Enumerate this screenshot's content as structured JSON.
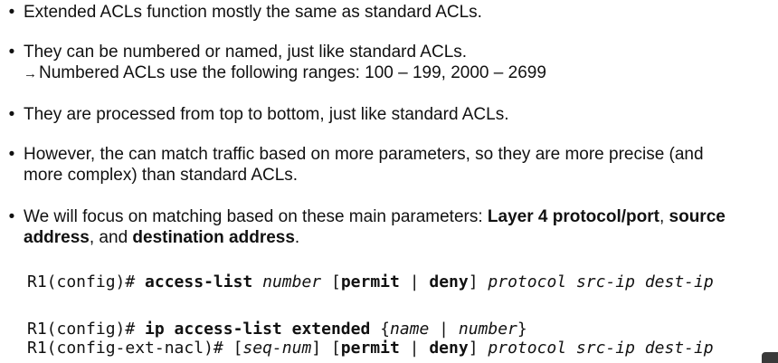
{
  "bullets": {
    "b1": {
      "text": "Extended ACLs function mostly the same as standard ACLs."
    },
    "b2": {
      "text": "They can be numbered or named, just like standard ACLs.",
      "sub_arrow": "→",
      "sub_text": "Numbered ACLs use the following ranges: 100 – 199, 2000 – 2699"
    },
    "b3": {
      "text": "They are processed from top to bottom, just like standard ACLs."
    },
    "b4": {
      "line1": "However, the can match traffic based on more parameters, so they are more precise (and",
      "line2": "more complex) than standard ACLs."
    },
    "b5": {
      "prefix": "We will focus on matching based on these main parameters: ",
      "bold1": "Layer 4 protocol/port",
      "sep1": ", ",
      "bold2a": "source",
      "bold2b": "address",
      "sep2": ", and ",
      "bold3": "destination address",
      "end": "."
    },
    "bullet_char": "•"
  },
  "code": {
    "numbered": {
      "prompt": "R1(config)# ",
      "cmd": "access-list",
      "arg1": "number",
      "open": " [",
      "permit": "permit",
      "pipe": " | ",
      "deny": "deny",
      "close": "] ",
      "rest": "protocol src-ip dest-ip"
    },
    "named_line1": {
      "prompt": "R1(config)# ",
      "cmd": "ip access-list extended",
      "open": " {",
      "name": "name",
      "pipe": " | ",
      "number": "number",
      "close": "}"
    },
    "named_line2": {
      "prompt": "R1(config-ext-nacl)# ",
      "open1": "[",
      "seq": "seq-num",
      "close1": "] [",
      "permit": "permit",
      "pipe": " | ",
      "deny": "deny",
      "close2": "] ",
      "rest": "protocol src-ip dest-ip"
    }
  }
}
